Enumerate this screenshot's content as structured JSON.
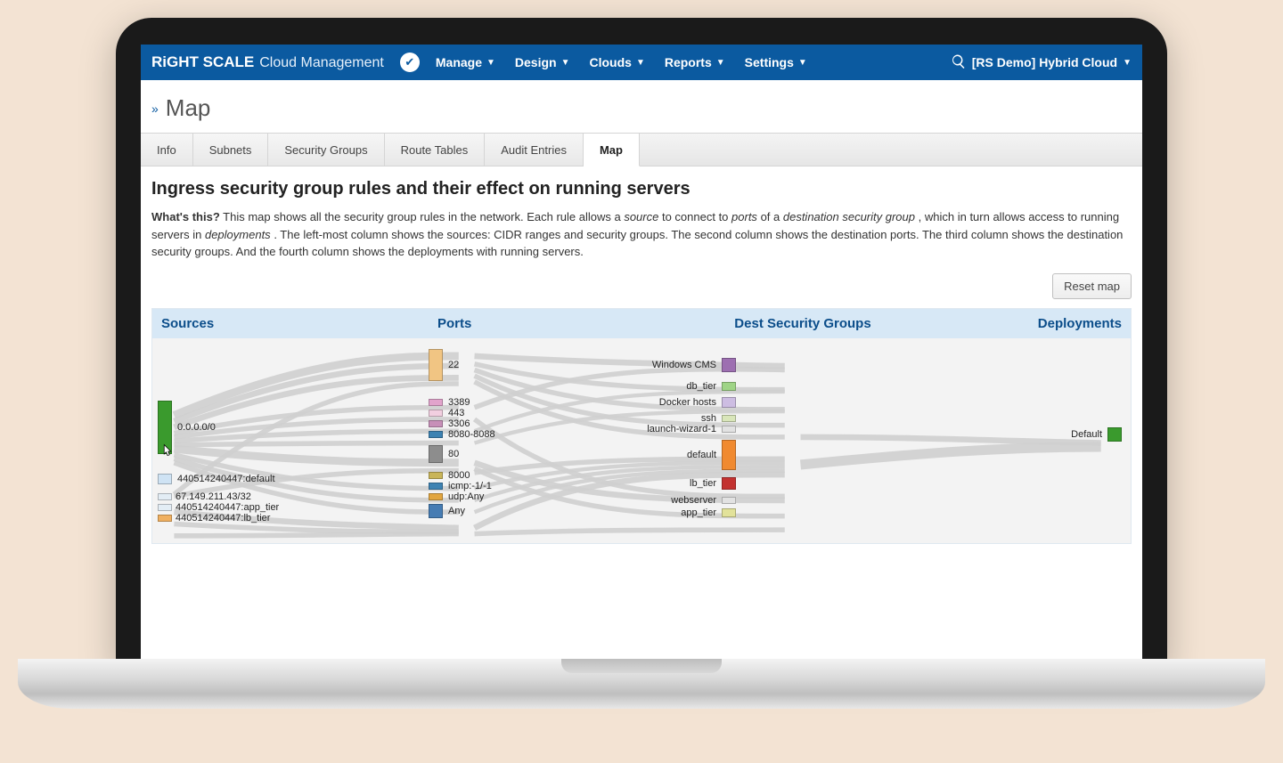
{
  "header": {
    "brand_primary": "RiGHT SCALE",
    "brand_secondary": "Cloud Management",
    "nav": {
      "manage": "Manage",
      "design": "Design",
      "clouds": "Clouds",
      "reports": "Reports",
      "settings": "Settings"
    },
    "account": "[RS Demo] Hybrid Cloud"
  },
  "breadcrumb": {
    "title": "Map"
  },
  "tabs": {
    "info": "Info",
    "subnets": "Subnets",
    "secgrp": "Security Groups",
    "routes": "Route Tables",
    "audit": "Audit Entries",
    "map": "Map"
  },
  "page": {
    "heading": "Ingress security group rules and their effect on running servers",
    "desc_lead": "What's this?",
    "desc_1a": "This map shows all the security group rules in the network. Each rule allows a ",
    "desc_em1": "source",
    "desc_1b": " to connect to ",
    "desc_em2": "ports",
    "desc_1c": " of a ",
    "desc_em3": "destination security group",
    "desc_1d": ", which in turn allows access to running servers in ",
    "desc_em4": "deployments",
    "desc_1e": ". The left-most column shows the sources: CIDR ranges and security groups. The second column shows the destination ports. The third column shows the destination security groups. And the fourth column shows the deployments with running servers.",
    "reset": "Reset map"
  },
  "sankey": {
    "cols": {
      "sources": "Sources",
      "ports": "Ports",
      "dsg": "Dest Security Groups",
      "deploy": "Deployments"
    },
    "sources": {
      "any": "0.0.0.0/0",
      "def": "440514240447:default",
      "ip": "67.149.211.43/32",
      "app": "440514240447:app_tier",
      "lb": "440514240447:lb_tier"
    },
    "ports": {
      "p22": "22",
      "p3389": "3389",
      "p443": "443",
      "p3306": "3306",
      "p8080": "8080-8088",
      "p80": "80",
      "p8000": "8000",
      "picmp": "icmp:-1/-1",
      "pudp": "udp:Any",
      "pany": "Any"
    },
    "dsg": {
      "win": "Windows CMS",
      "db": "db_tier",
      "docker": "Docker hosts",
      "ssh": "ssh",
      "lw": "launch-wizard-1",
      "def": "default",
      "lb": "lb_tier",
      "ws": "webserver",
      "app": "app_tier"
    },
    "deploy": {
      "def": "Default"
    }
  },
  "chart_data": {
    "type": "sankey",
    "columns": [
      "Sources",
      "Ports",
      "Dest Security Groups",
      "Deployments"
    ],
    "nodes": {
      "sources": [
        {
          "id": "src_any",
          "label": "0.0.0.0/0",
          "color": "#3a9a2d",
          "weight": 10
        },
        {
          "id": "src_def",
          "label": "440514240447:default",
          "color": "#cfe3f4",
          "weight": 3
        },
        {
          "id": "src_ip",
          "label": "67.149.211.43/32",
          "color": "#e3edf5",
          "weight": 1
        },
        {
          "id": "src_app",
          "label": "440514240447:app_tier",
          "color": "#e3edf5",
          "weight": 1
        },
        {
          "id": "src_lb",
          "label": "440514240447:lb_tier",
          "color": "#f0b060",
          "weight": 1
        }
      ],
      "ports": [
        {
          "id": "p22",
          "label": "22",
          "color": "#f1c583",
          "weight": 6
        },
        {
          "id": "p3389",
          "label": "3389",
          "color": "#e2a4cc",
          "weight": 1
        },
        {
          "id": "p443",
          "label": "443",
          "color": "#f2cfe0",
          "weight": 1
        },
        {
          "id": "p3306",
          "label": "3306",
          "color": "#c78fb8",
          "weight": 1
        },
        {
          "id": "p8080",
          "label": "8080-8088",
          "color": "#3d82b2",
          "weight": 1
        },
        {
          "id": "p80",
          "label": "80",
          "color": "#8d8d8d",
          "weight": 3
        },
        {
          "id": "p8000",
          "label": "8000",
          "color": "#c9b559",
          "weight": 1
        },
        {
          "id": "picmp",
          "label": "icmp:-1/-1",
          "color": "#3d82b2",
          "weight": 1
        },
        {
          "id": "pudp",
          "label": "udp:Any",
          "color": "#e2a640",
          "weight": 1
        },
        {
          "id": "pany",
          "label": "Any",
          "color": "#467cb3",
          "weight": 2
        }
      ],
      "dsg": [
        {
          "id": "d_win",
          "label": "Windows CMS",
          "color": "#9d6fb1",
          "weight": 2
        },
        {
          "id": "d_db",
          "label": "db_tier",
          "color": "#9fd486",
          "weight": 1
        },
        {
          "id": "d_docker",
          "label": "Docker hosts",
          "color": "#cdbde2",
          "weight": 2
        },
        {
          "id": "d_ssh",
          "label": "ssh",
          "color": "#d9e6ba",
          "weight": 1
        },
        {
          "id": "d_lw",
          "label": "launch-wizard-1",
          "color": "#e2e2e2",
          "weight": 1
        },
        {
          "id": "d_def",
          "label": "default",
          "color": "#f08a30",
          "weight": 5
        },
        {
          "id": "d_lb",
          "label": "lb_tier",
          "color": "#c33230",
          "weight": 2
        },
        {
          "id": "d_ws",
          "label": "webserver",
          "color": "#e2e2e2",
          "weight": 1
        },
        {
          "id": "d_app",
          "label": "app_tier",
          "color": "#e2e29a",
          "weight": 1
        }
      ],
      "deployments": [
        {
          "id": "dep_def",
          "label": "Default",
          "color": "#3a9a2d",
          "weight": 3
        }
      ]
    },
    "links": [
      {
        "from": "src_any",
        "to": "p22",
        "value": 5
      },
      {
        "from": "src_any",
        "to": "p3389",
        "value": 1
      },
      {
        "from": "src_any",
        "to": "p443",
        "value": 1
      },
      {
        "from": "src_any",
        "to": "p3306",
        "value": 1
      },
      {
        "from": "src_any",
        "to": "p8080",
        "value": 1
      },
      {
        "from": "src_any",
        "to": "p80",
        "value": 2
      },
      {
        "from": "src_any",
        "to": "p8000",
        "value": 1
      },
      {
        "from": "src_any",
        "to": "picmp",
        "value": 1
      },
      {
        "from": "src_any",
        "to": "pudp",
        "value": 1
      },
      {
        "from": "src_def",
        "to": "p22",
        "value": 1
      },
      {
        "from": "src_def",
        "to": "p80",
        "value": 1
      },
      {
        "from": "src_def",
        "to": "pany",
        "value": 1
      },
      {
        "from": "src_ip",
        "to": "p22",
        "value": 1
      },
      {
        "from": "src_app",
        "to": "p3306",
        "value": 1
      },
      {
        "from": "src_lb",
        "to": "pany",
        "value": 1
      },
      {
        "from": "p22",
        "to": "d_win",
        "value": 1
      },
      {
        "from": "p22",
        "to": "d_db",
        "value": 1
      },
      {
        "from": "p22",
        "to": "d_docker",
        "value": 1
      },
      {
        "from": "p22",
        "to": "d_ssh",
        "value": 1
      },
      {
        "from": "p22",
        "to": "d_lw",
        "value": 1
      },
      {
        "from": "p22",
        "to": "d_def",
        "value": 1
      },
      {
        "from": "p3389",
        "to": "d_win",
        "value": 1
      },
      {
        "from": "p443",
        "to": "d_lb",
        "value": 1
      },
      {
        "from": "p3306",
        "to": "d_db",
        "value": 1
      },
      {
        "from": "p8080",
        "to": "d_docker",
        "value": 1
      },
      {
        "from": "p80",
        "to": "d_lb",
        "value": 1
      },
      {
        "from": "p80",
        "to": "d_ws",
        "value": 1
      },
      {
        "from": "p80",
        "to": "d_def",
        "value": 1
      },
      {
        "from": "p8000",
        "to": "d_def",
        "value": 1
      },
      {
        "from": "picmp",
        "to": "d_def",
        "value": 1
      },
      {
        "from": "pudp",
        "to": "d_def",
        "value": 1
      },
      {
        "from": "pany",
        "to": "d_def",
        "value": 1
      },
      {
        "from": "pany",
        "to": "d_app",
        "value": 1
      },
      {
        "from": "d_def",
        "to": "dep_def",
        "value": 3
      },
      {
        "from": "d_lw",
        "to": "dep_def",
        "value": 1
      }
    ]
  }
}
